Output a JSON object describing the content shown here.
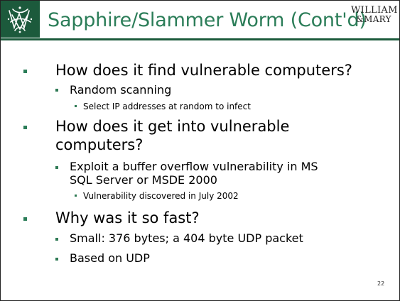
{
  "slide": {
    "title": "Sapphire/Slammer Worm (Cont'd)",
    "brand_line1": "WILLIAM",
    "brand_line2": "&MARY",
    "page_number": "22",
    "colors": {
      "title": "#2b7d58",
      "logo_bg": "#1c5a3c",
      "rule": "#1c5a3c",
      "bullet_l1": "#2b7d58",
      "bullet_sub": "#2f7a55",
      "body_text": "#000000"
    },
    "icons": {
      "logo": "cypher-monogram-icon"
    }
  },
  "content": {
    "q1": "How does it find vulnerable computers?",
    "q1_a1": "Random scanning",
    "q1_a1_d1": "Select IP addresses at random to infect",
    "q2_line1": "How does it get into vulnerable",
    "q2_line2": "computers?",
    "q2_a1_line1": "Exploit a buffer overflow vulnerability in MS",
    "q2_a1_line2": "SQL Server or MSDE 2000",
    "q2_a1_d1": "Vulnerability discovered in July 2002",
    "q3": "Why was it so fast?",
    "q3_a1": "Small: 376 bytes; a 404 byte UDP packet",
    "q3_a2": "Based on UDP"
  }
}
